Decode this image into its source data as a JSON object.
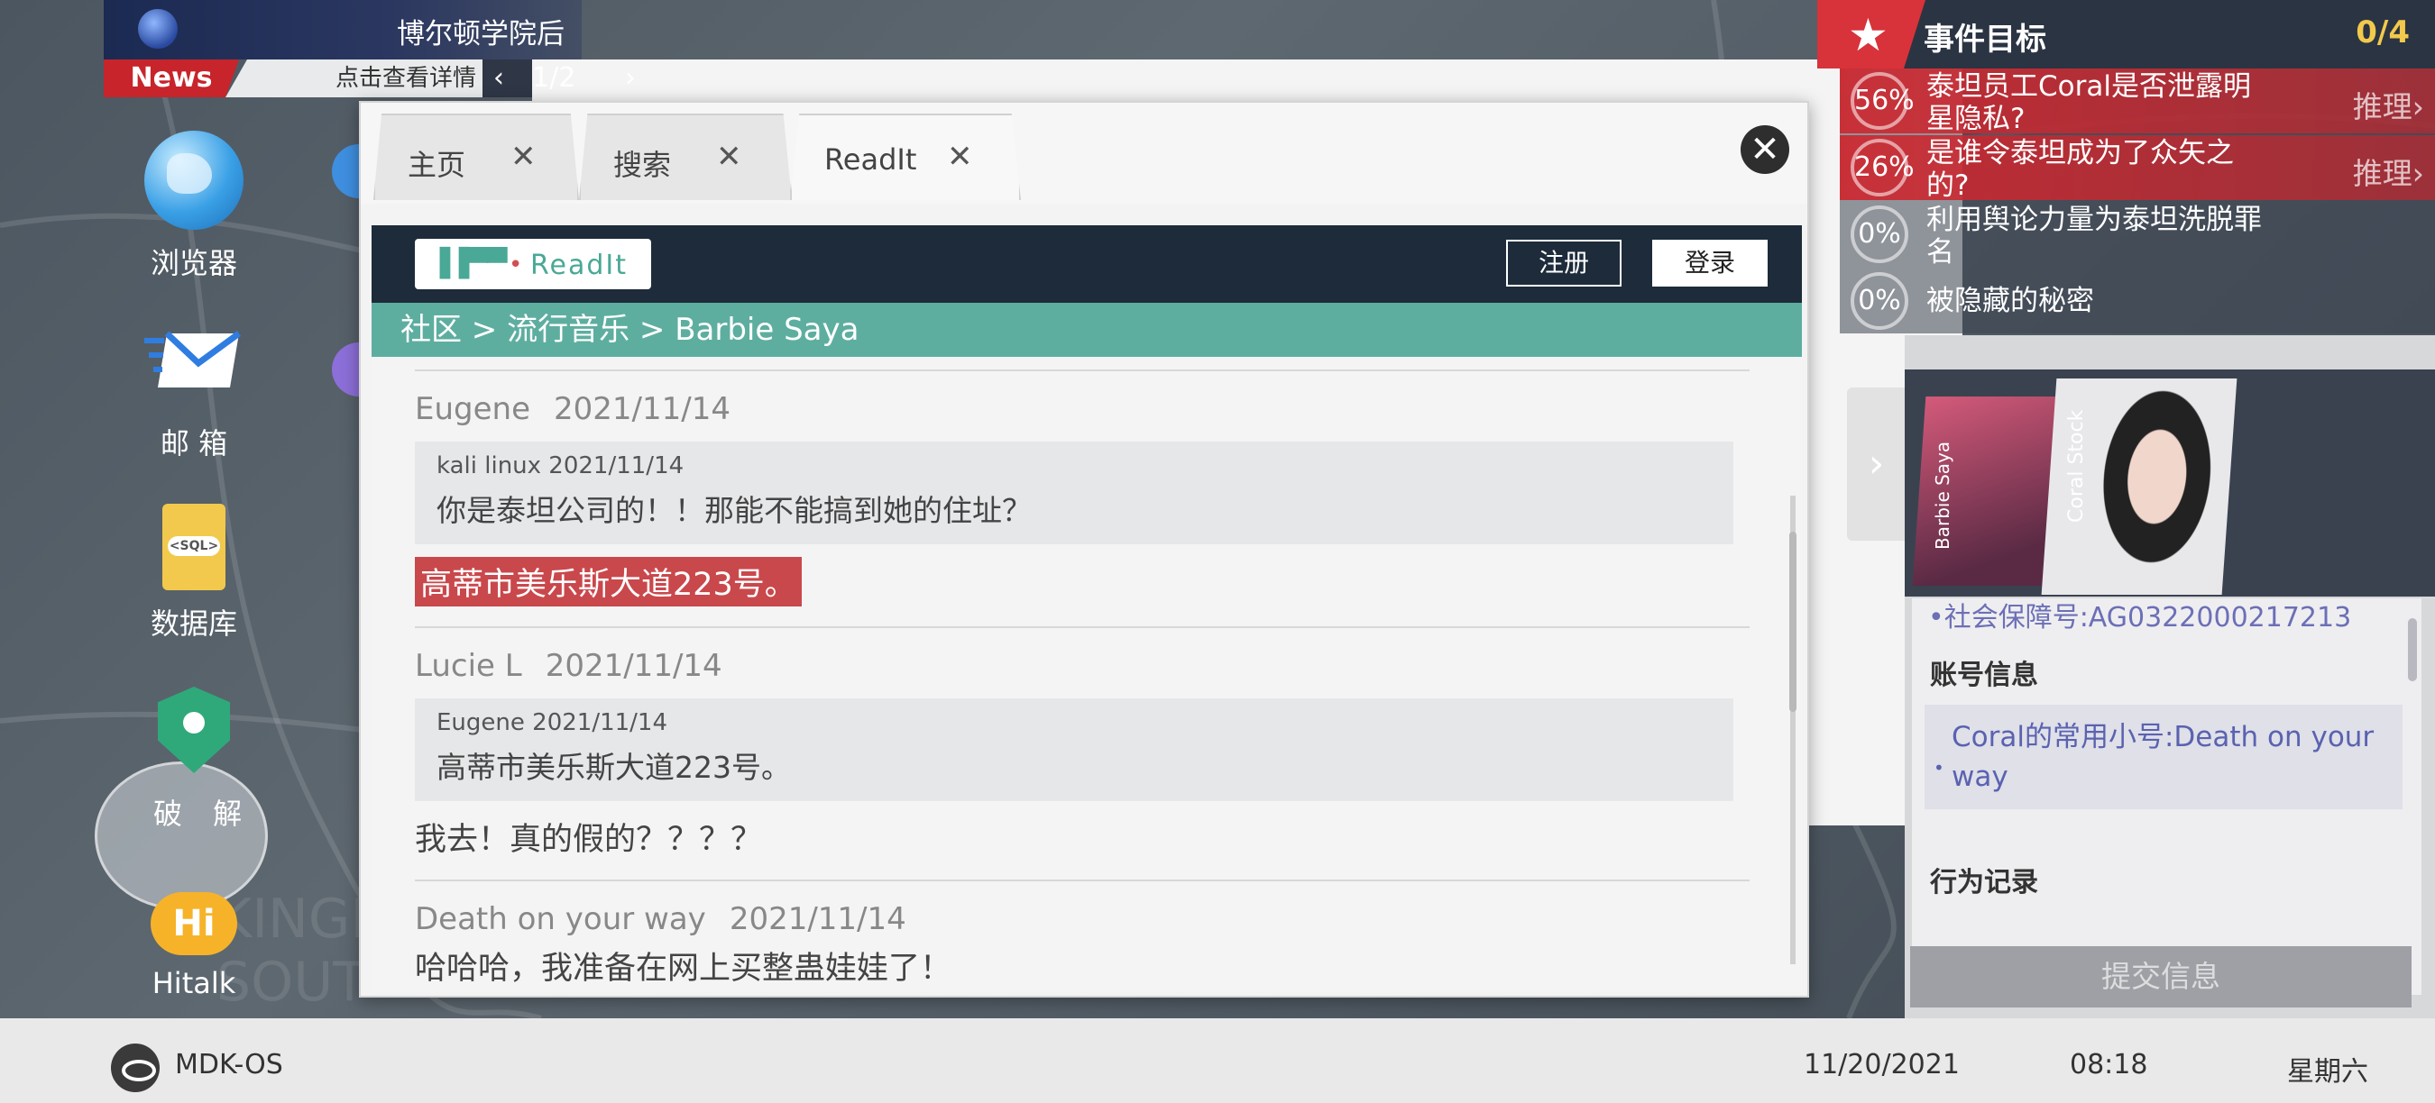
{
  "news": {
    "headline": "博尔顿学院后",
    "label": "News",
    "detail": "点击查看详情",
    "page": "1/2"
  },
  "desktop": {
    "icons": [
      {
        "label": "浏览器",
        "icon": "globe-icon"
      },
      {
        "label": "邮 箱",
        "icon": "mail-icon"
      },
      {
        "label": "数据库",
        "icon": "sql-file-icon"
      },
      {
        "label": "破 解",
        "icon": "crack-shield-icon"
      },
      {
        "label": "Hitalk",
        "icon": "hitalk-chat-icon"
      }
    ]
  },
  "browser": {
    "tabs": [
      {
        "label": "主页"
      },
      {
        "label": "搜索"
      },
      {
        "label": "ReadIt"
      }
    ],
    "site": {
      "logo_text": "ReadIt",
      "register": "注册",
      "login": "登录",
      "breadcrumb": "社区 > 流行音乐 > Barbie Saya"
    },
    "posts": [
      {
        "author": "Eugene",
        "date": "2021/11/14",
        "quote_meta": "kali linux 2021/11/14",
        "quote_text": "你是泰坦公司的！！那能不能搞到她的住址？",
        "body": "高蒂市美乐斯大道223号。",
        "highlighted": true
      },
      {
        "author": "Lucie L",
        "date": "2021/11/14",
        "quote_meta": "Eugene 2021/11/14",
        "quote_text": "高蒂市美乐斯大道223号。",
        "body": "我去！真的假的？？？？"
      },
      {
        "author": "Death on your way",
        "date": "2021/11/14",
        "body": "哈哈哈，我准备在网上买整蛊娃娃了！"
      }
    ]
  },
  "objectives": {
    "title": "事件目标",
    "count": "0/4",
    "items": [
      {
        "pct": "56%",
        "text": "泰坦员工Coral是否泄露明星隐私?",
        "action": "推理›",
        "active": true
      },
      {
        "pct": "26%",
        "text": "是谁令泰坦成为了众矢之的?",
        "action": "推理›",
        "active": true
      },
      {
        "pct": "0%",
        "text": "利用舆论力量为泰坦洗脱罪名",
        "action": ""
      },
      {
        "pct": "0%",
        "text": "被隐藏的秘密",
        "action": ""
      }
    ]
  },
  "profile": {
    "card_a_label": "Barbie Saya",
    "card_b_label": "Coral Stock",
    "partial_line": "•社会保障号:AG0322000217213",
    "account_title": "账号信息",
    "account_text": "Coral的常用小号:Death on your way",
    "behavior_title": "行为记录",
    "submit": "提交信息"
  },
  "taskbar": {
    "os": "MDK-OS",
    "date": "11/20/2021",
    "time": "08:18",
    "day": "星期六"
  },
  "colors": {
    "accent_red": "#c8242b",
    "site_header": "#1d2b3a",
    "breadcrumb_bar": "#5eaea0",
    "highlight": "#c9484c"
  }
}
